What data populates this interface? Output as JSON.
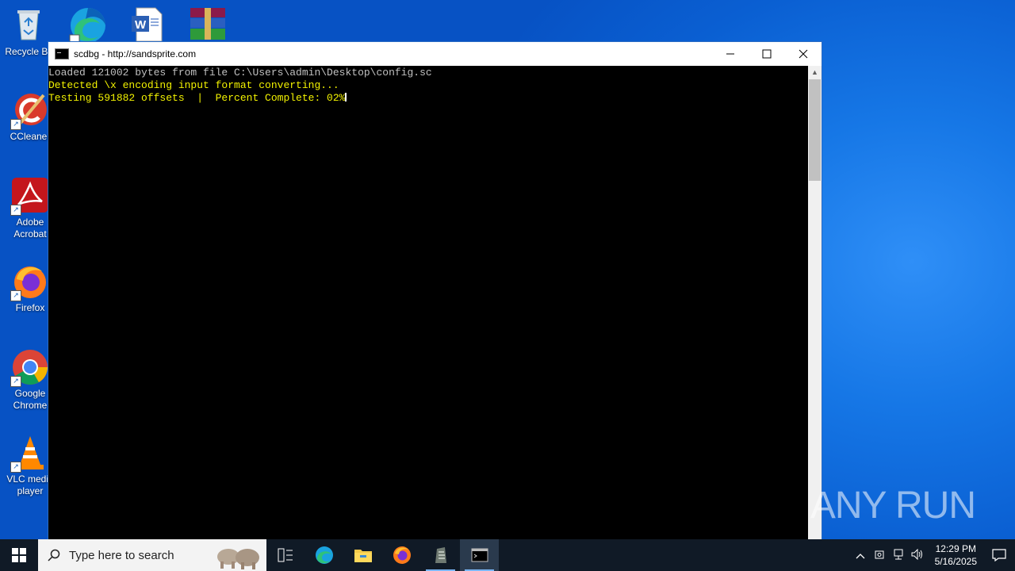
{
  "desktop": {
    "icons": [
      {
        "label": "Recycle Bin"
      },
      {
        "label": "CCleaner"
      },
      {
        "label": "Adobe Acrobat"
      },
      {
        "label": "Firefox"
      },
      {
        "label": "Google Chrome"
      },
      {
        "label": "VLC media player"
      }
    ]
  },
  "window": {
    "title": "scdbg - http://sandsprite.com",
    "minimize": "—",
    "maximize": "☐",
    "close": "✕"
  },
  "console": {
    "lines": [
      {
        "text": "Loaded 121002 bytes from file C:\\Users\\admin\\Desktop\\config.sc",
        "color": "#c0c0c0"
      },
      {
        "text": "Detected \\x encoding input format converting...",
        "color": "#f2f200"
      },
      {
        "text": "Testing 591882 offsets  |  Percent Complete: 02%",
        "color": "#f2f200"
      }
    ]
  },
  "watermark": "ANY RUN",
  "taskbar": {
    "search_placeholder": "Type here to search",
    "time": "12:29 PM",
    "date": "5/16/2025"
  }
}
